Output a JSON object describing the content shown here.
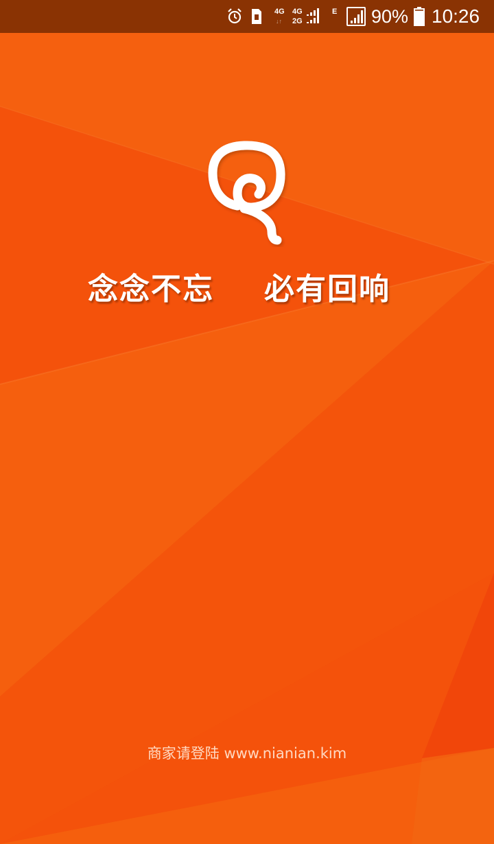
{
  "status_bar": {
    "time": "10:26",
    "battery_percent": "90%",
    "battery_level": 0.9,
    "network_primary_top": "4G",
    "network_secondary_top": "4G",
    "network_secondary_bottom": "2G",
    "data_type": "E",
    "icons": [
      "alarm-icon",
      "sim-icon",
      "signal-icon",
      "signal-icon",
      "signal-icon",
      "battery-icon"
    ]
  },
  "splash": {
    "logo_icon": "swirl-logo-icon",
    "slogan_left": "念念不忘",
    "slogan_right": "必有回响",
    "footer_text": "商家请登陆 www.nianian.kim"
  },
  "colors": {
    "background": "#f4520b",
    "status_bar": "#8a3303",
    "text": "#ffffff"
  }
}
